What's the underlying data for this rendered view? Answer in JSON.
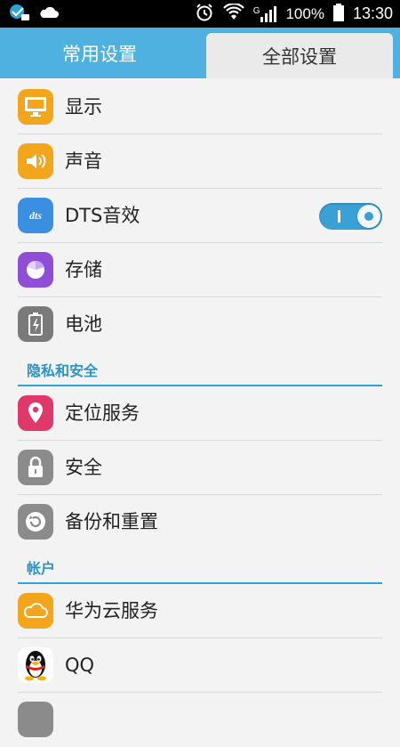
{
  "status_bar": {
    "network_type": "G",
    "battery_percent": "100%",
    "time": "13:30"
  },
  "tabs": [
    {
      "label": "常用设置",
      "active": false
    },
    {
      "label": "全部设置",
      "active": true
    }
  ],
  "items_group1": [
    {
      "label": "显示",
      "icon": "display-icon",
      "color": "#f3a51b"
    },
    {
      "label": "声音",
      "icon": "speaker-icon",
      "color": "#f3a51b"
    },
    {
      "label": "DTS音效",
      "icon": "dts-icon",
      "color": "#3a8fe0",
      "toggle": true,
      "toggle_on": true
    },
    {
      "label": "存储",
      "icon": "storage-pie-icon",
      "color": "#8e4ed8"
    },
    {
      "label": "电池",
      "icon": "battery-icon",
      "color": "#7a7a7a"
    }
  ],
  "section_privacy": {
    "label": "隐私和安全"
  },
  "items_group2": [
    {
      "label": "定位服务",
      "icon": "location-pin-icon",
      "color": "#e0386a"
    },
    {
      "label": "安全",
      "icon": "lock-icon",
      "color": "#8b8b8b"
    },
    {
      "label": "备份和重置",
      "icon": "backup-restore-icon",
      "color": "#8b8b8b"
    }
  ],
  "section_accounts": {
    "label": "帐户"
  },
  "items_group3": [
    {
      "label": "华为云服务",
      "icon": "cloud-icon",
      "color": "#f3a51b"
    },
    {
      "label": "QQ",
      "icon": "qq-penguin-icon",
      "color": "#ffffff"
    }
  ]
}
